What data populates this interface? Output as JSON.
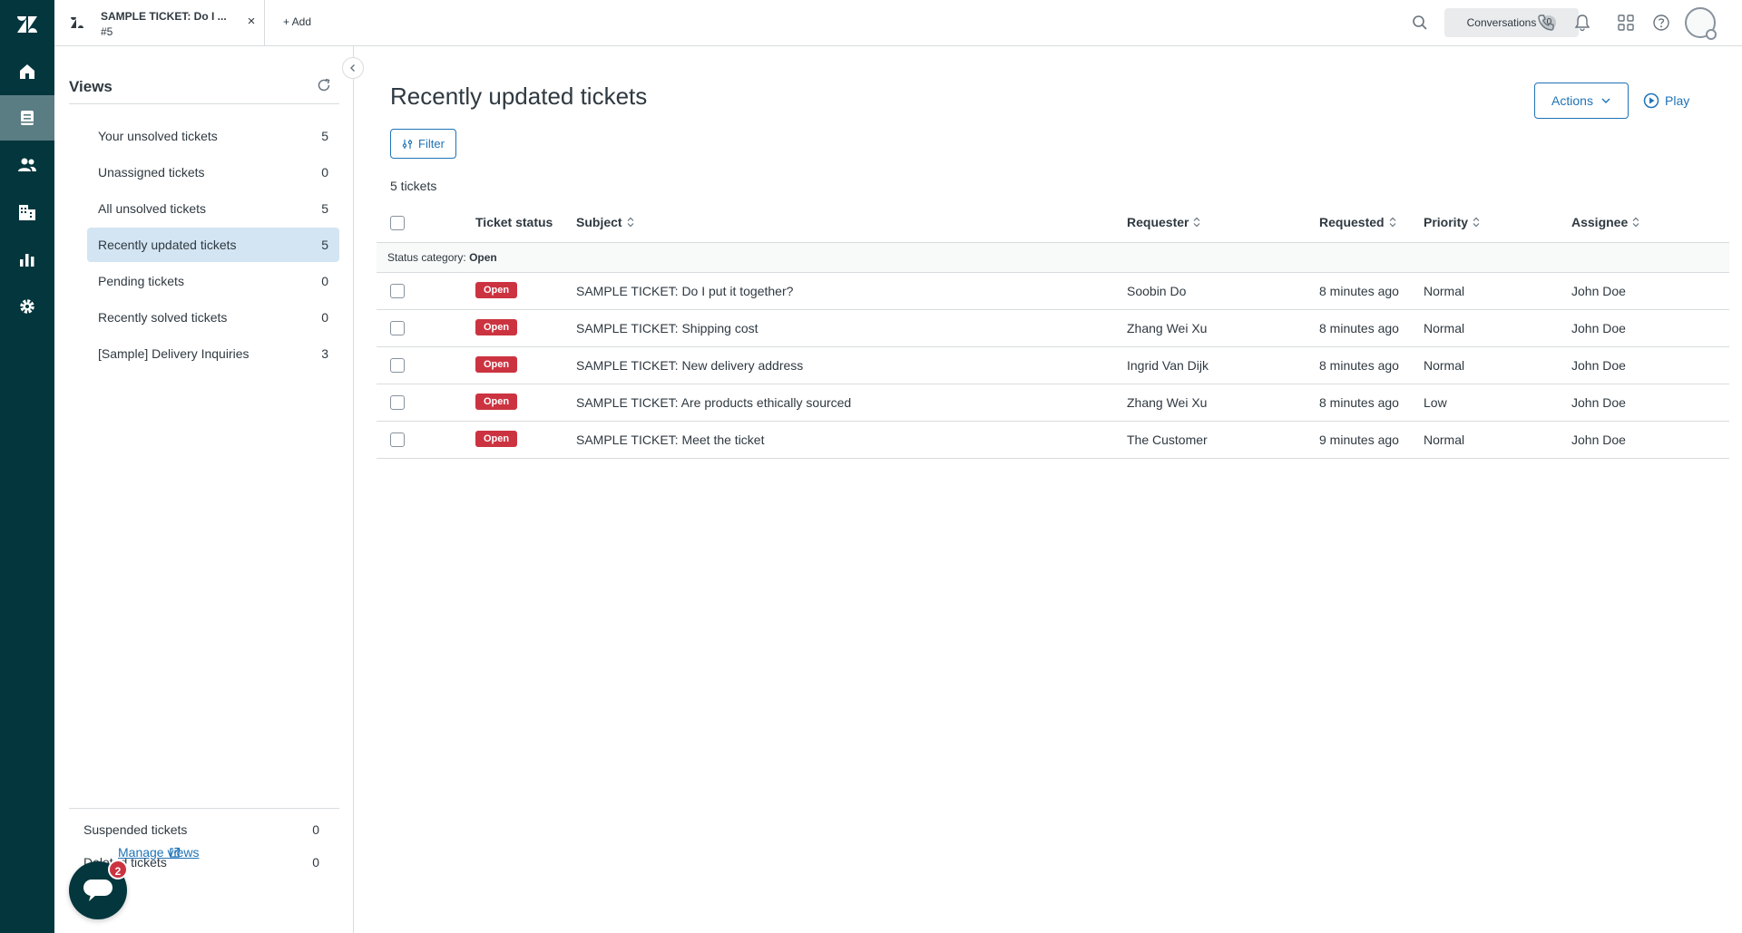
{
  "tab": {
    "title": "SAMPLE TICKET: Do I ...",
    "subtitle": "#5",
    "close_glyph": "×",
    "add_label": "+ Add"
  },
  "header": {
    "conversations_label": "Conversations",
    "conversations_count": "0"
  },
  "views": {
    "title": "Views",
    "items": [
      {
        "label": "Your unsolved tickets",
        "count": "5"
      },
      {
        "label": "Unassigned tickets",
        "count": "0"
      },
      {
        "label": "All unsolved tickets",
        "count": "5"
      },
      {
        "label": "Recently updated tickets",
        "count": "5"
      },
      {
        "label": "Pending tickets",
        "count": "0"
      },
      {
        "label": "Recently solved tickets",
        "count": "0"
      },
      {
        "label": "[Sample] Delivery Inquiries",
        "count": "3"
      }
    ],
    "bottom_items": [
      {
        "label": "Suspended tickets",
        "count": "0"
      },
      {
        "label": "Deleted tickets",
        "count": "0"
      }
    ],
    "manage_link": "Manage views",
    "chat_badge": "2"
  },
  "main": {
    "title": "Recently updated tickets",
    "actions_label": "Actions",
    "play_label": "Play",
    "filter_label": "Filter",
    "ticket_count": "5 tickets"
  },
  "table": {
    "columns": {
      "status": "Ticket status",
      "subject": "Subject",
      "requester": "Requester",
      "requested": "Requested",
      "priority": "Priority",
      "assignee": "Assignee"
    },
    "group_prefix": "Status category:",
    "group_value": "Open",
    "rows": [
      {
        "status": "Open",
        "subject": "SAMPLE TICKET: Do I put it together?",
        "requester": "Soobin Do",
        "requested": "8 minutes ago",
        "priority": "Normal",
        "assignee": "John Doe"
      },
      {
        "status": "Open",
        "subject": "SAMPLE TICKET: Shipping cost",
        "requester": "Zhang Wei Xu",
        "requested": "8 minutes ago",
        "priority": "Normal",
        "assignee": "John Doe"
      },
      {
        "status": "Open",
        "subject": "SAMPLE TICKET: New delivery address",
        "requester": "Ingrid Van Dijk",
        "requested": "8 minutes ago",
        "priority": "Normal",
        "assignee": "John Doe"
      },
      {
        "status": "Open",
        "subject": "SAMPLE TICKET: Are products ethically sourced",
        "requester": "Zhang Wei Xu",
        "requested": "8 minutes ago",
        "priority": "Low",
        "assignee": "John Doe"
      },
      {
        "status": "Open",
        "subject": "SAMPLE TICKET: Meet the ticket",
        "requester": "The Customer",
        "requested": "9 minutes ago",
        "priority": "Normal",
        "assignee": "John Doe"
      }
    ]
  },
  "colors": {
    "rail": "#03363d",
    "accent": "#1f73b7",
    "open_status": "#cc3340",
    "active_view": "#d3e5f2"
  },
  "icons": [
    "zendesk-logo-icon",
    "home-icon",
    "tickets-icon",
    "customers-icon",
    "organizations-icon",
    "reporting-icon",
    "admin-gear-icon",
    "search-icon",
    "phone-icon",
    "bell-icon",
    "apps-grid-icon",
    "help-icon",
    "refresh-icon",
    "chevron-left-icon",
    "chevron-down-icon",
    "play-circle-icon",
    "filter-icon",
    "sort-icon",
    "external-link-icon",
    "chat-icon"
  ]
}
